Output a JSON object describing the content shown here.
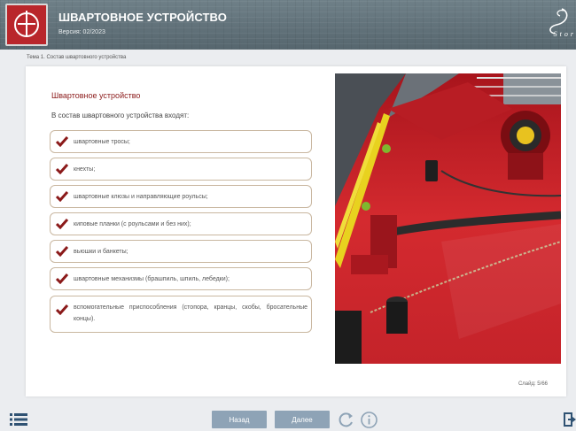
{
  "header": {
    "title": "ШВАРТОВНОЕ УСТРОЙСТВО",
    "version": "Версия: 02/2023",
    "brand_word": "Stor"
  },
  "breadcrumb": "Тема 1. Состав швартовного устройства",
  "slide": {
    "title": "Швартовное устройство",
    "intro": "В состав швартовного устройства входят:",
    "items": [
      "швартовные тросы;",
      "кнехты;",
      "швартовные клюзы и направляющие роульсы;",
      "киповые планки (с роульсами и без них);",
      "вьюшки и банкеты;",
      "швартовные механизмы (брашпиль, шпиль, лебедки);",
      "вспомогательные приспособления (стопора, кранцы, скобы, бросательные концы)."
    ],
    "counter": "Слайд: 5/66"
  },
  "footer": {
    "prev_label": "Назад",
    "next_label": "Далее",
    "menu_icon": "list-menu-icon",
    "reload_icon": "reload-icon",
    "info_icon": "info-icon",
    "exit_icon": "exit-icon"
  },
  "colors": {
    "header_bg": "#5f6f77",
    "title_red": "#8b1a1a",
    "check_red": "#8b1a1a",
    "nav_button": "#8ea3b6",
    "deck_red": "#c9202a"
  }
}
